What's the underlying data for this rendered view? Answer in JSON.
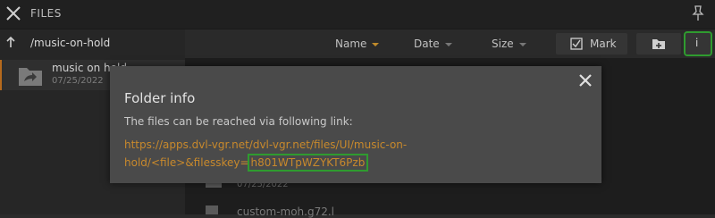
{
  "header": {
    "title": "FILES"
  },
  "left": {
    "path": "/music-on-hold",
    "entry": {
      "name": "music on hold",
      "date": "07/25/2022"
    }
  },
  "toolbar": {
    "sort_name": "Name",
    "sort_date": "Date",
    "sort_size": "Size",
    "mark_label": "Mark",
    "info_label": "i"
  },
  "background_rows": {
    "date": "07/25/2022",
    "file": "custom-moh.g72.l"
  },
  "dialog": {
    "title": "Folder info",
    "text": "The files can be reached via following link:",
    "link_prefix": "https://apps.dvl-vgr.net/dvl-vgr.net/files/UI/music-on-hold/<file>&filesskey=",
    "link_key": "h801WTpWZYKT6Pzb"
  },
  "colors": {
    "accent": "#c8892c",
    "highlight": "#2f9b2f"
  }
}
